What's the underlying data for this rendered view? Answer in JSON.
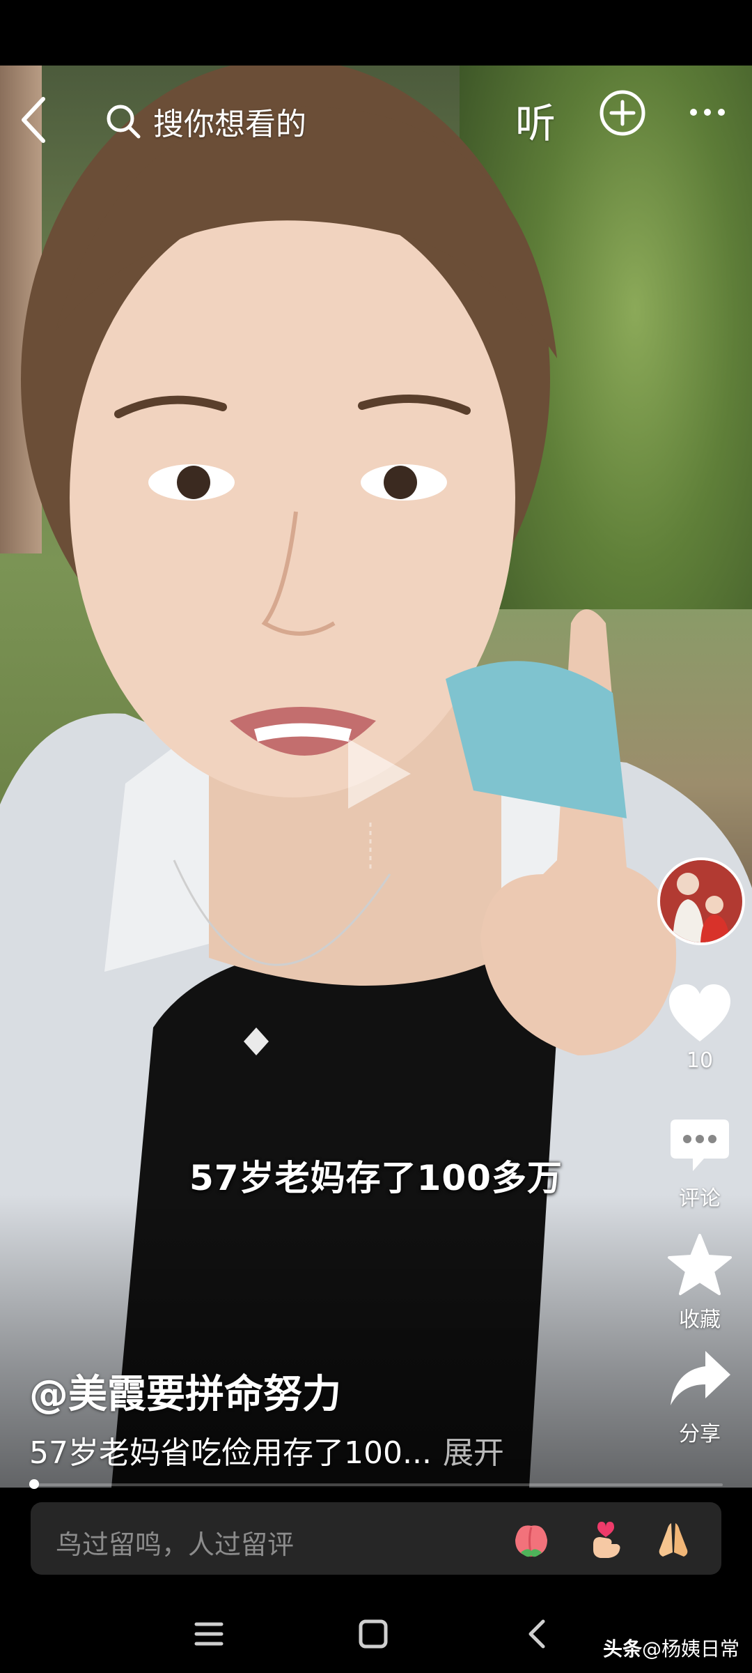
{
  "topbar": {
    "search_placeholder": "搜你想看的",
    "listen_label": "听"
  },
  "video": {
    "subtitle": "57岁老妈存了100多万"
  },
  "rail": {
    "like_count": "10",
    "comment_label": "评论",
    "favorite_label": "收藏",
    "share_label": "分享"
  },
  "post": {
    "author": "@美霞要拼命努力",
    "description": "57岁老妈省吃俭用存了100...",
    "expand_label": "展开"
  },
  "comment_bar": {
    "placeholder": "鸟过留鸣，人过留评"
  },
  "watermark": {
    "app": "头条",
    "handle": "@杨姨日常"
  },
  "progress": {
    "fraction": 0.01
  },
  "colors": {
    "background": "#000000",
    "comment_bar_bg": "#262626",
    "placeholder_text": "#8c8c8c",
    "accent_white": "#ffffff"
  },
  "icons": {
    "back": "chevron-left-icon",
    "search": "search-icon",
    "add": "plus-circle-icon",
    "more": "more-dots-icon",
    "like": "heart-icon",
    "comment": "chat-bubble-icon",
    "favorite": "star-icon",
    "share": "share-arrow-icon",
    "emoji_1": "peach-emoji",
    "emoji_2": "finger-heart-emoji",
    "emoji_3": "pray-hands-emoji"
  }
}
